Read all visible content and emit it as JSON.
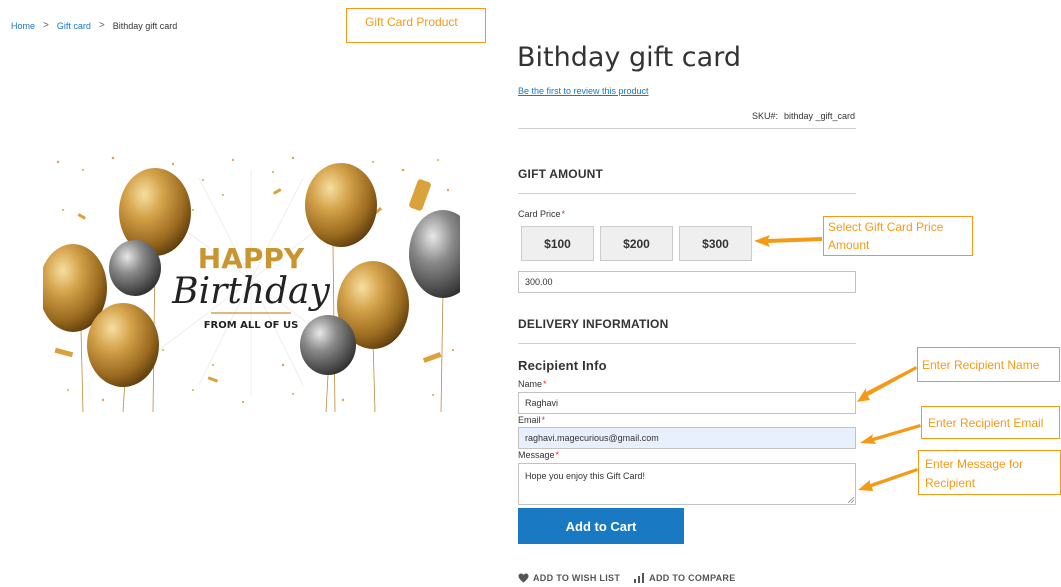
{
  "breadcrumb": {
    "home": "Home",
    "separator": ">",
    "category": "Gift card",
    "current": "Bithday gift card"
  },
  "callouts": {
    "product": "Gift Card Product",
    "price_line1": "Select Gift Card Price",
    "price_line2": "Amount",
    "name": "Enter Recipient Name",
    "email": "Enter Recipient Email",
    "message_line1": "Enter Message for",
    "message_line2": "Recipient"
  },
  "image": {
    "happy": "HAPPY",
    "birthday": "Birthday",
    "from": "FROM ALL OF US"
  },
  "product": {
    "title": "Bithday gift card",
    "review_link": "Be the first to review this product",
    "sku_label": "SKU#:",
    "sku_value": "bithday _gift_card"
  },
  "gift_amount": {
    "heading": "GIFT AMOUNT",
    "card_price_label": "Card Price",
    "required_mark": "*",
    "options": [
      "$100",
      "$200",
      "$300"
    ],
    "amount_value": "300.00"
  },
  "delivery": {
    "heading": "DELIVERY INFORMATION",
    "recipient_heading": "Recipient Info",
    "name_label": "Name",
    "name_value": "Raghavi",
    "email_label": "Email",
    "email_value": "raghavi.magecurious@gmail.com",
    "message_label": "Message",
    "message_value": "Hope you enjoy this Gift Card!"
  },
  "actions": {
    "add_to_cart": "Add to Cart",
    "wishlist": "ADD TO WISH LIST",
    "compare": "ADD TO COMPARE"
  },
  "colors": {
    "accent": "#1979c3",
    "callout": "#f49a16",
    "required": "#e02b27"
  }
}
